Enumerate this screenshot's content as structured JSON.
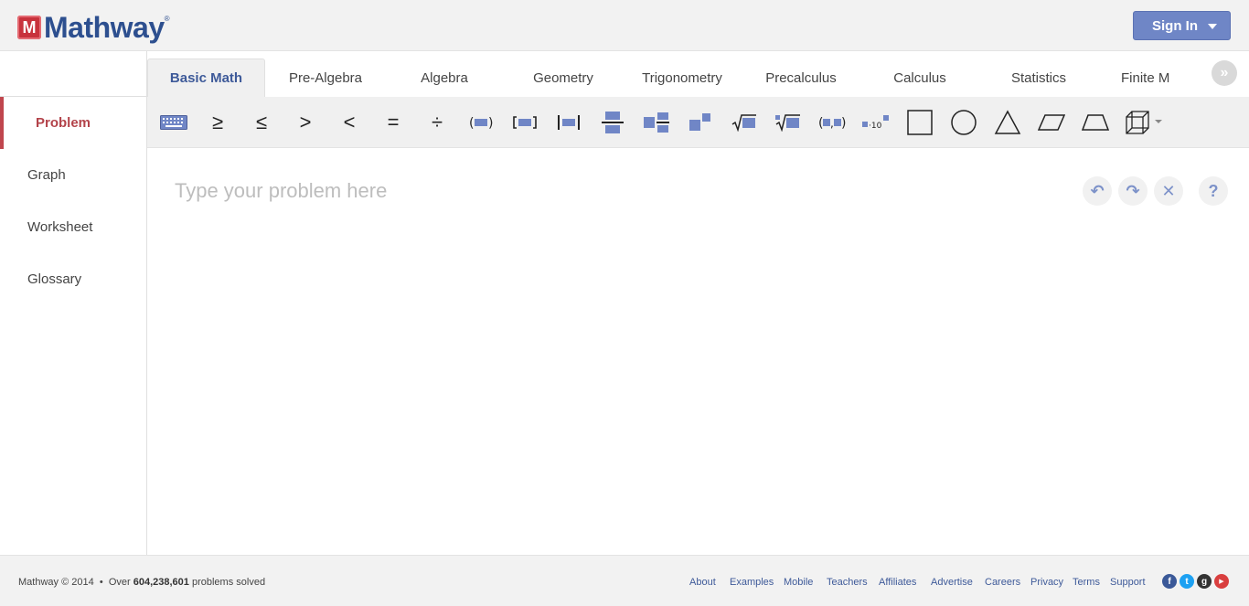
{
  "header": {
    "logo_mark": "M",
    "logo_text": "Mathway",
    "logo_tm": "®",
    "signin_label": "Sign In"
  },
  "tabs": [
    {
      "label": "Basic Math",
      "active": true
    },
    {
      "label": "Pre-Algebra"
    },
    {
      "label": "Algebra"
    },
    {
      "label": "Geometry"
    },
    {
      "label": "Trigonometry"
    },
    {
      "label": "Precalculus"
    },
    {
      "label": "Calculus"
    },
    {
      "label": "Statistics"
    },
    {
      "label": "Finite M"
    }
  ],
  "tabs_more_glyph": "»",
  "sidebar": {
    "items": [
      {
        "label": "Problem",
        "active": true
      },
      {
        "label": "Graph"
      },
      {
        "label": "Worksheet"
      },
      {
        "label": "Glossary"
      }
    ]
  },
  "toolbar": {
    "symbols": {
      "ge": "≥",
      "le": "≤",
      "gt": ">",
      "lt": "<",
      "eq": "=",
      "div": "÷",
      "sqrt": "√",
      "exp_label": "10"
    },
    "tools": [
      "keyboard-icon",
      "greater-equal",
      "less-equal",
      "greater-than",
      "less-than",
      "equals",
      "divide",
      "parentheses",
      "brackets",
      "absolute-value",
      "fraction",
      "mixed-number",
      "exponent",
      "square-root",
      "nth-root",
      "ordered-pair",
      "scientific-notation",
      "square",
      "circle",
      "triangle",
      "parallelogram",
      "trapezoid",
      "cube"
    ]
  },
  "editor": {
    "placeholder": "Type your problem here",
    "buttons": {
      "undo": "↶",
      "redo": "↷",
      "clear": "✕",
      "help": "?"
    }
  },
  "footer": {
    "copyright": "Mathway © 2014",
    "bullet": "•",
    "solved_prefix": "Over",
    "solved_count": "604,238,601",
    "solved_suffix": "problems solved",
    "links": [
      "About",
      "Examples",
      "Mobile",
      "Teachers",
      "Affiliates",
      "Advertise",
      "Careers",
      "Privacy",
      "Terms",
      "Support"
    ],
    "social": [
      {
        "name": "facebook-icon",
        "glyph": "f",
        "color": "#3b5998"
      },
      {
        "name": "twitter-icon",
        "glyph": "t",
        "color": "#1da1f2"
      },
      {
        "name": "googleplus-icon",
        "glyph": "g",
        "color": "#333333"
      },
      {
        "name": "youtube-icon",
        "glyph": "▶",
        "color": "#d93f3f"
      }
    ]
  },
  "colors": {
    "brand": "#2d4f8f",
    "accent": "#6f86c6",
    "active_red": "#b3434a"
  }
}
